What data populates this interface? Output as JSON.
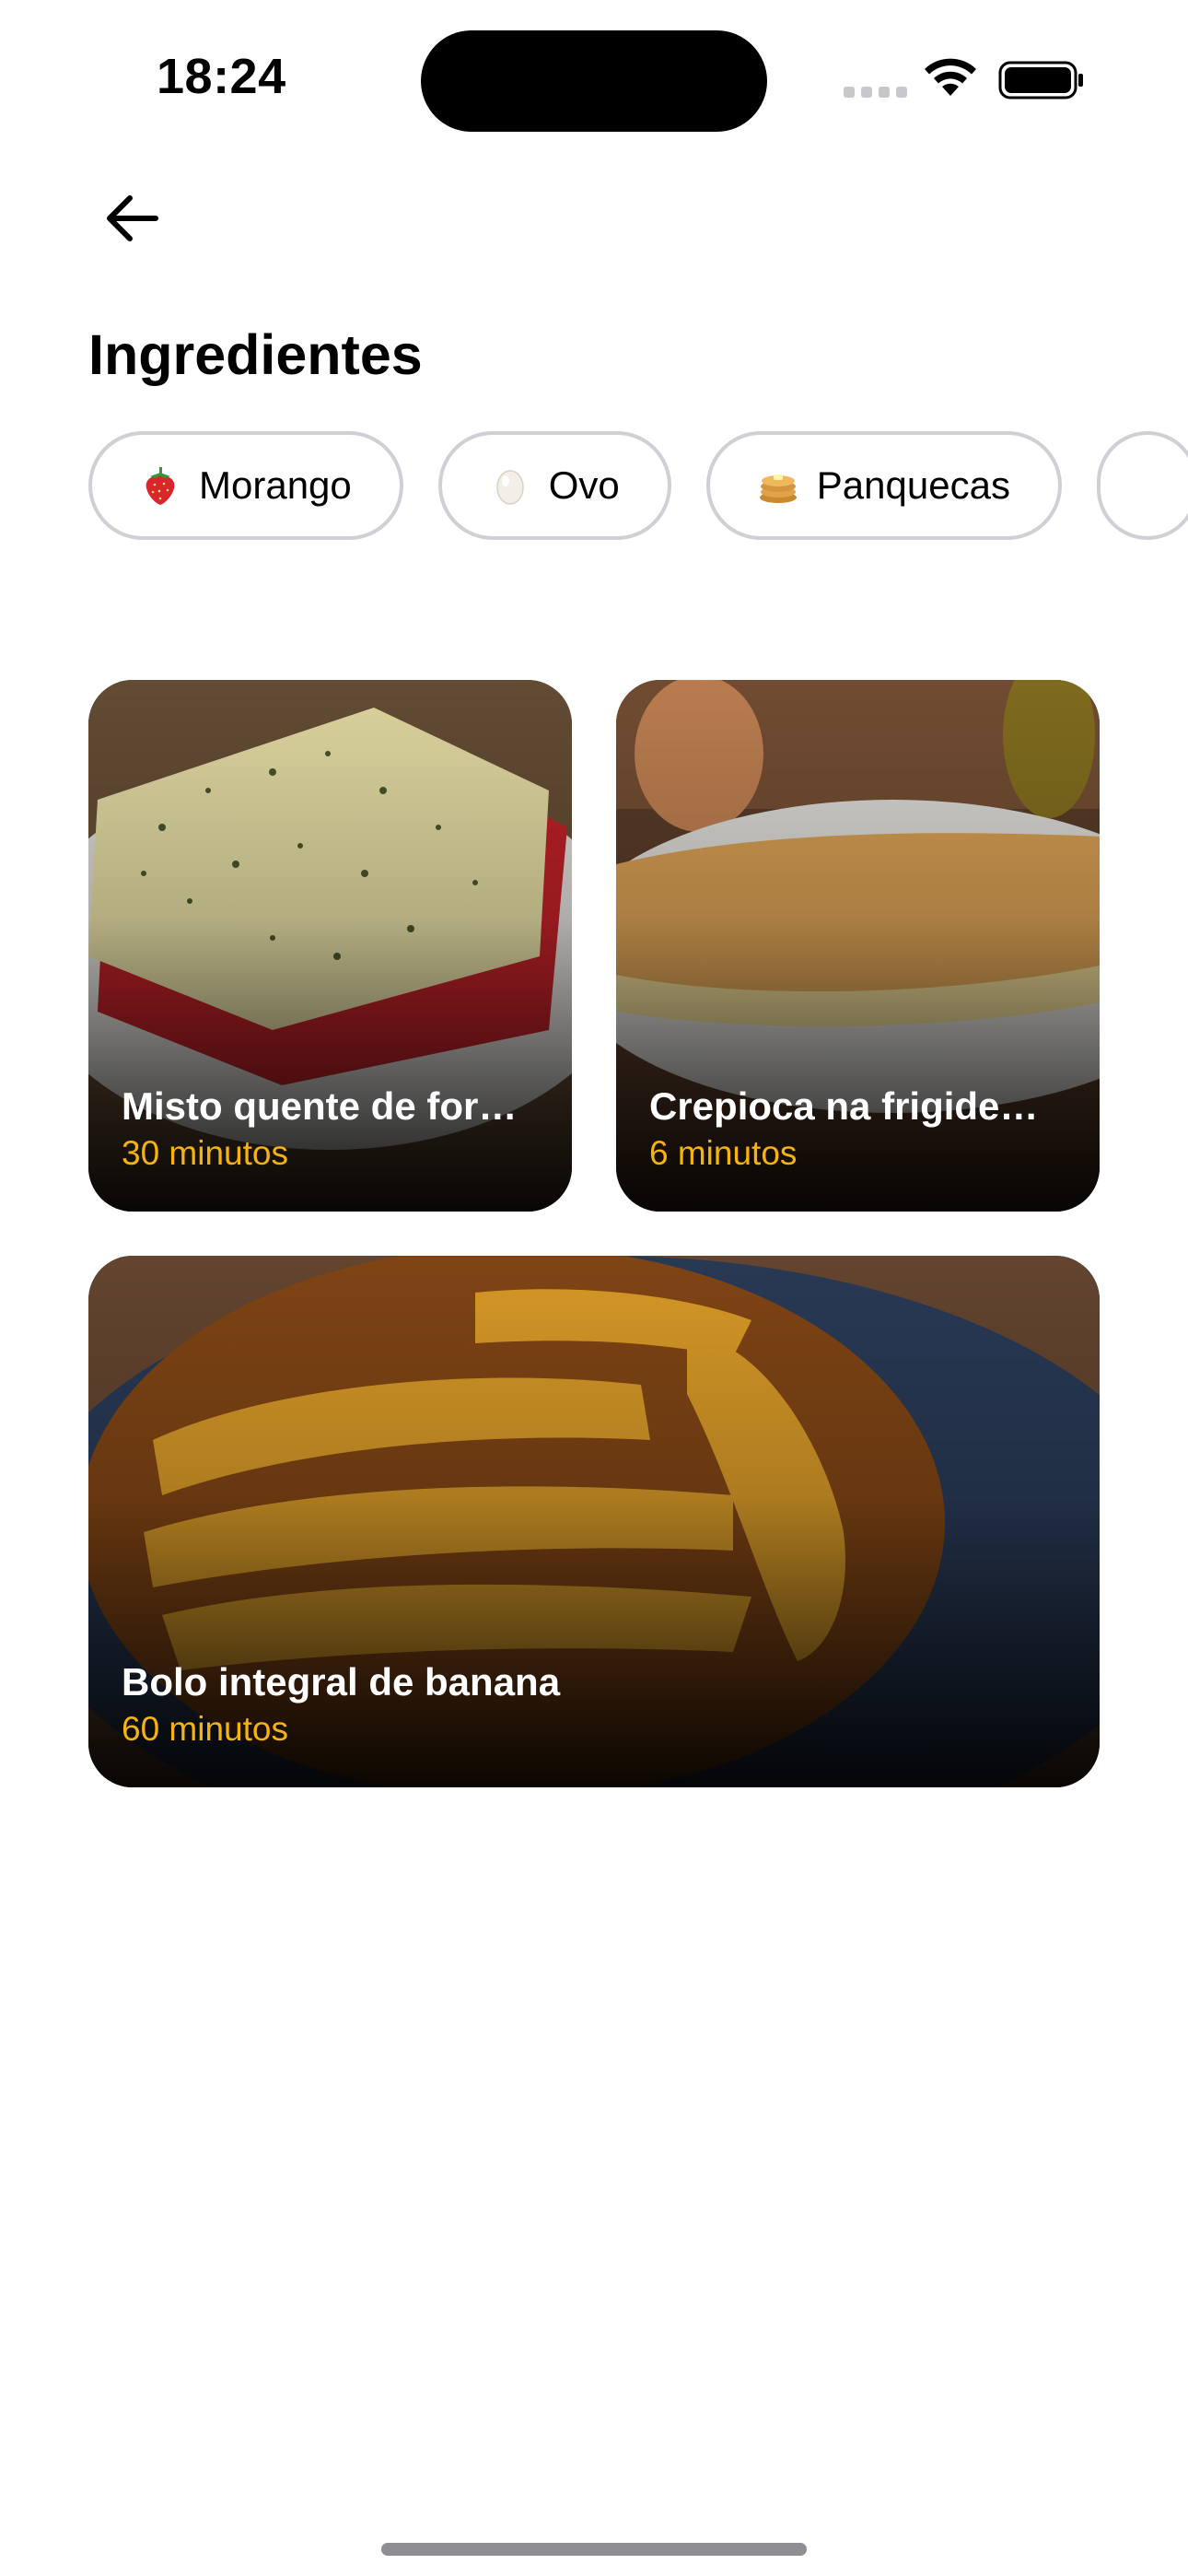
{
  "status_bar": {
    "time": "18:24"
  },
  "header": {
    "title": "Ingredientes"
  },
  "ingredients": [
    {
      "label": "Morango",
      "icon": "strawberry-icon"
    },
    {
      "label": "Ovo",
      "icon": "egg-icon"
    },
    {
      "label": "Panquecas",
      "icon": "pancakes-icon"
    },
    {
      "label": "",
      "icon": ""
    }
  ],
  "recipes": [
    {
      "title": "Misto quente de for…",
      "time": "30 minutos"
    },
    {
      "title": "Crepioca na frigide…",
      "time": "6 minutos"
    },
    {
      "title": "Bolo integral de banana",
      "time": "60 minutos"
    }
  ],
  "colors": {
    "accent_time": "#f5b30b",
    "chip_border": "#cfcfd6"
  }
}
